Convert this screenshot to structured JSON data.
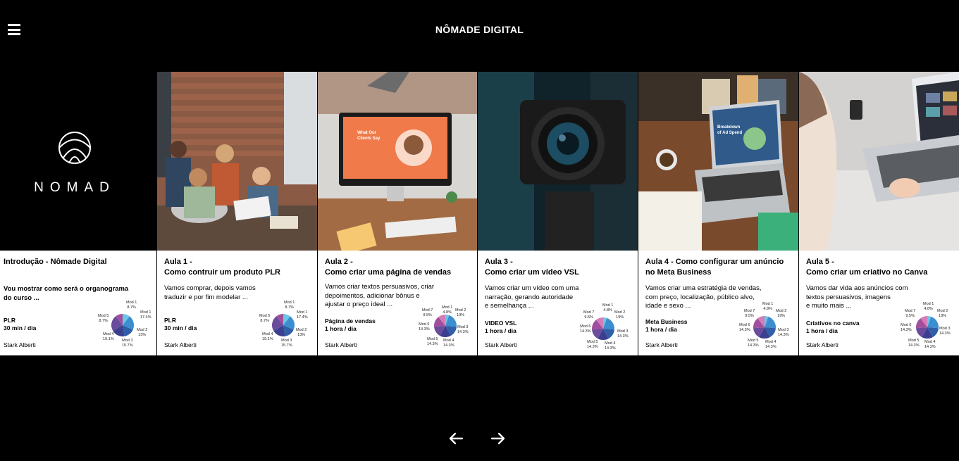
{
  "header": {
    "title": "NÔMADE DIGITAL",
    "menu_icon": "hamburger-menu-icon"
  },
  "cards": [
    {
      "title": "Introdução - Nômade Digital",
      "description": "Vou mostrar como será o organograma\ndo curso ...",
      "category": "PLR",
      "duration": "30 min / dia",
      "author": "Stark Alberti",
      "logo_text": "NOMAD",
      "chart_labels": [
        "Mod 1\n8.7%",
        "Mod 1\n17.4%",
        "Mod 2\n13%",
        "Mod 3\n15.7%",
        "Mod 4\n19.1%",
        "Mod 5\n8.7%"
      ]
    },
    {
      "title": "Aula 1 -\nComo contruir um produto PLR",
      "description": "Vamos comprar, depois vamos\ntraduzir e  por fim modelar ...",
      "category": "PLR",
      "duration": "30 min / dia",
      "author": "Stark Alberti",
      "chart_labels": [
        "Mod 1\n8.7%",
        "Mod 1\n17.4%",
        "Mod 2\n13%",
        "Mod 3\n15.7%",
        "Mod 4\n19.1%",
        "Mod 5\n8.7%"
      ]
    },
    {
      "title": "Aula 2 -\nComo criar uma página de vendas",
      "description": "Vamos criar textos persuasivos, criar\ndepoimentos, adicionar bônus e\najustar o preço ideal ...",
      "category": "Página de vendas",
      "duration": "1 hora / dia",
      "author": "Stark Alberti",
      "screen_text": "What Our\nClients Say",
      "chart_labels": [
        "Mod 1\n4.8%",
        "Mod 2\n19%",
        "Mod 3\n14.3%",
        "Mod 4\n14.3%",
        "Mod 5\n14.3%",
        "Mod 6\n14.3%",
        "Mod 7\n9.5%"
      ]
    },
    {
      "title": "Aula 3 -\nComo criar um vídeo VSL",
      "description": "Vamos criar um vídeo com uma\nnarração, gerando autoridade\ne semelhança ...",
      "category": "VIDEO VSL",
      "duration": "1 hora / dia",
      "author": "Stark Alberti",
      "chart_labels": [
        "Mod 1\n4.8%",
        "Mod 2\n19%",
        "Mod 3\n14.3%",
        "Mod 4\n14.3%",
        "Mod 5\n14.3%",
        "Mod 6\n14.3%",
        "Mod 7\n9.5%"
      ]
    },
    {
      "title": "Aula 4 - Como configurar um anúncio\nno Meta Business",
      "description": "Vamos criar uma estratégia de vendas,\ncom preço, localização, público alvo,\nidade e sexo ...",
      "category": "Meta Business",
      "duration": "1 hora / dia",
      "author": "Stark Alberti",
      "screen_text": "Breakdown\nof Ad Spend",
      "chart_labels": [
        "Mod 1\n4.8%",
        "Mod 2\n19%",
        "Mod 3\n14.3%",
        "Mod 4\n14.3%",
        "Mod 5\n14.3%",
        "Mod 6\n14.3%",
        "Mod 7\n9.5%"
      ]
    },
    {
      "title": "Aula 5 -\nComo criar um criativo no Canva",
      "description": "Vamos dar vida aos anúncios com\ntextos persuasivos, imagens\ne muito mais ...",
      "category": "Criativos no canva",
      "duration": "1 hora / dia",
      "author": "Stark Alberti",
      "chart_labels": [
        "Mod 1\n4.8%",
        "Mod 2\n19%",
        "Mod 3\n14.3%",
        "Mod 4\n14.3%",
        "Mod 5\n14.3%",
        "Mod 6\n14.3%",
        "Mod 7\n9.5%"
      ]
    }
  ],
  "pie_charts": {
    "six_module": [
      8.7,
      17.4,
      13,
      15.7,
      19.1,
      8.7
    ],
    "seven_module": [
      4.8,
      19,
      14.3,
      14.3,
      14.3,
      14.3,
      9.5
    ],
    "colors": [
      "#6ec6e6",
      "#3b8fd0",
      "#2f5fa8",
      "#3a3f8f",
      "#6a4b9c",
      "#a04f9c",
      "#d47cb8"
    ]
  },
  "nav": {
    "prev_icon": "arrow-left-icon",
    "next_icon": "arrow-right-icon"
  }
}
